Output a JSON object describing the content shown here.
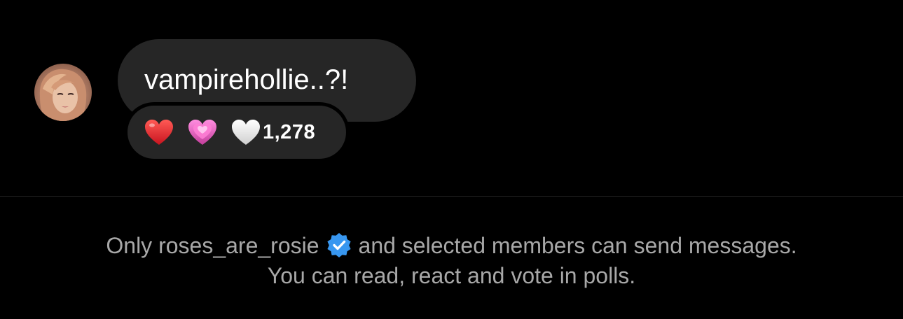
{
  "message": {
    "text": "vampirehollie..?!",
    "reactions": {
      "emojis": [
        {
          "name": "red-heart",
          "color": "#e0202b"
        },
        {
          "name": "sparkling-pink-heart",
          "color": "#e45cbf"
        },
        {
          "name": "white-heart",
          "color": "#f2f2f2"
        }
      ],
      "count": "1,278"
    }
  },
  "notice": {
    "line1_prefix": "Only",
    "username": "roses_are_rosie",
    "line1_suffix": "and selected members can send messages.",
    "line2": "You can read, react and vote in polls.",
    "verified_color": "#3897f0"
  },
  "colors": {
    "background": "#000000",
    "bubble": "#262626",
    "notice_text": "#a8a8a8"
  }
}
